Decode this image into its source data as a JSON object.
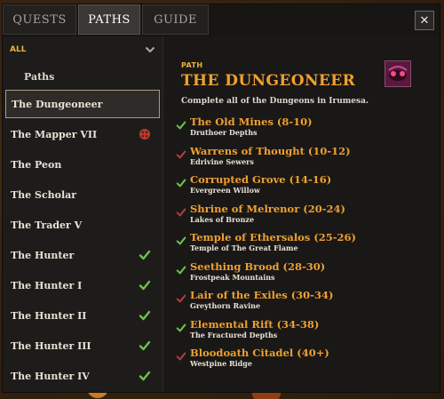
{
  "tabs": [
    {
      "label": "QUESTS",
      "active": false
    },
    {
      "label": "PATHS",
      "active": true
    },
    {
      "label": "GUIDE",
      "active": false
    }
  ],
  "close_label": "✕",
  "filter": {
    "label": "ALL"
  },
  "sidebar": {
    "section_label": "Paths",
    "items": [
      {
        "label": "The Dungeoneer",
        "status": "selected"
      },
      {
        "label": "The Mapper VII",
        "status": "pending"
      },
      {
        "label": "The Peon",
        "status": "none"
      },
      {
        "label": "The Scholar",
        "status": "none"
      },
      {
        "label": "The Trader V",
        "status": "none"
      },
      {
        "label": "The Hunter",
        "status": "complete"
      },
      {
        "label": "The Hunter I",
        "status": "complete"
      },
      {
        "label": "The Hunter II",
        "status": "complete"
      },
      {
        "label": "The Hunter III",
        "status": "complete"
      },
      {
        "label": "The Hunter IV",
        "status": "complete"
      }
    ]
  },
  "detail": {
    "label": "PATH",
    "title": "THE DUNGEONEER",
    "description": "Complete all of the Dungeons in Irumesa.",
    "icon": "dungeon-creature-icon",
    "dungeons": [
      {
        "name": "The Old Mines (8-10)",
        "location": "Druthoer Depths",
        "done": true
      },
      {
        "name": "Warrens of Thought (10-12)",
        "location": "Edrivine Sewers",
        "done": false
      },
      {
        "name": "Corrupted Grove (14-16)",
        "location": "Evergreen Willow",
        "done": true
      },
      {
        "name": "Shrine of Melrenor (20-24)",
        "location": "Lakes of Bronze",
        "done": false
      },
      {
        "name": "Temple of Ethersalos (25-26)",
        "location": "Temple of The Great Flame",
        "done": true
      },
      {
        "name": "Seething Brood (28-30)",
        "location": "Frostpeak Mountains",
        "done": true
      },
      {
        "name": "Lair of the Exiles (30-34)",
        "location": "Greythorn Ravine",
        "done": false
      },
      {
        "name": "Elemental Rift (34-38)",
        "location": "The Fractured Depths",
        "done": true
      },
      {
        "name": "Bloodoath Citadel (40+)",
        "location": "Westpine Ridge",
        "done": false
      }
    ]
  },
  "colors": {
    "accent_gold": "#e8b43a",
    "title_orange": "#f0a030",
    "check_green": "#6cc24a",
    "check_red": "#b83a3a",
    "pending_red": "#c0392b"
  }
}
